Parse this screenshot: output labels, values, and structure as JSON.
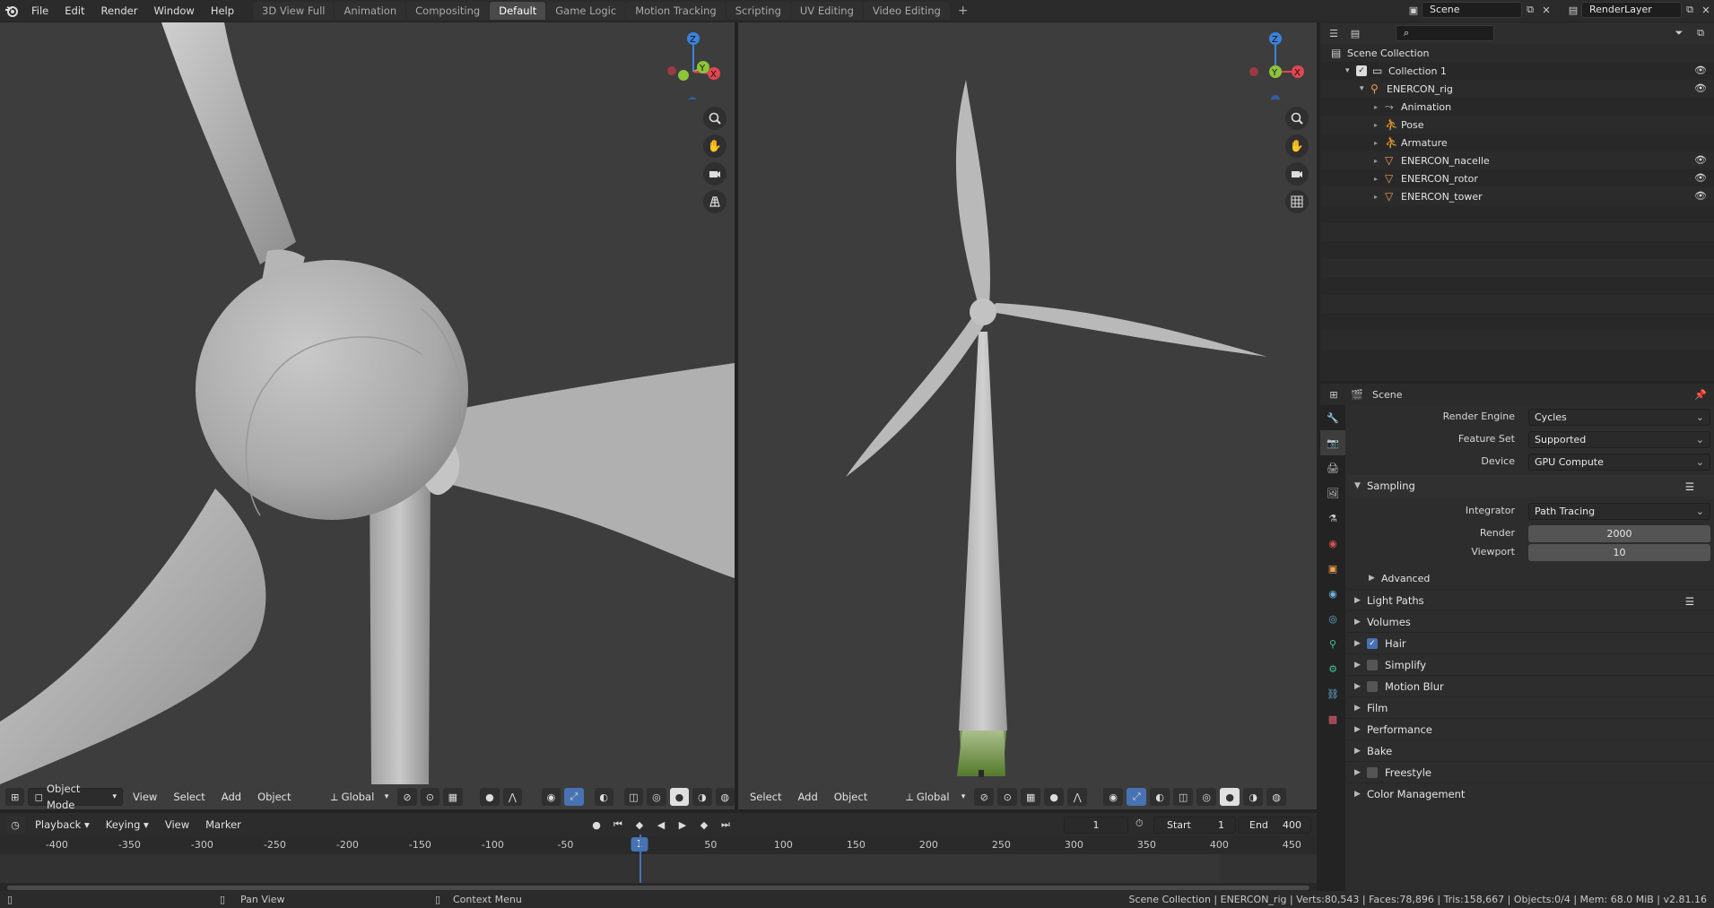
{
  "menu": [
    "File",
    "Edit",
    "Render",
    "Window",
    "Help"
  ],
  "workspace_tabs": [
    {
      "label": "3D View Full",
      "active": false
    },
    {
      "label": "Animation",
      "active": false
    },
    {
      "label": "Compositing",
      "active": false
    },
    {
      "label": "Default",
      "active": true
    },
    {
      "label": "Game Logic",
      "active": false
    },
    {
      "label": "Motion Tracking",
      "active": false
    },
    {
      "label": "Scripting",
      "active": false
    },
    {
      "label": "UV Editing",
      "active": false
    },
    {
      "label": "Video Editing",
      "active": false
    }
  ],
  "add_tab": "+",
  "scene": "Scene",
  "render_layer": "RenderLayer",
  "left_viewport": {
    "mode": "Object Mode",
    "menus": [
      "View",
      "Select",
      "Add",
      "Object"
    ],
    "orientation": "Global"
  },
  "right_viewport": {
    "menus": [
      "Select",
      "Add",
      "Object"
    ],
    "orientation": "Global"
  },
  "gizmo_axes": {
    "z": "Z",
    "y": "Y",
    "x": "X"
  },
  "outliner": {
    "rows": [
      {
        "label": "Scene Collection",
        "indent": 0,
        "icon": "scene-collection-icon",
        "eye": false
      },
      {
        "label": "Collection 1",
        "indent": 1,
        "icon": "collection-icon",
        "eye": true
      },
      {
        "label": "ENERCON_rig",
        "indent": 2,
        "icon": "armature-object-icon",
        "eye": true
      },
      {
        "label": "Animation",
        "indent": 3,
        "icon": "animation-icon",
        "eye": false
      },
      {
        "label": "Pose",
        "indent": 3,
        "icon": "pose-icon",
        "eye": false
      },
      {
        "label": "Armature",
        "indent": 3,
        "icon": "armature-data-icon",
        "eye": false
      },
      {
        "label": "ENERCON_nacelle",
        "indent": 3,
        "icon": "mesh-object-icon",
        "eye": true
      },
      {
        "label": "ENERCON_rotor",
        "indent": 3,
        "icon": "mesh-object-icon",
        "eye": true
      },
      {
        "label": "ENERCON_tower",
        "indent": 3,
        "icon": "mesh-object-icon",
        "eye": true
      }
    ]
  },
  "properties": {
    "context": "Scene",
    "render_engine_label": "Render Engine",
    "render_engine": "Cycles",
    "feature_set_label": "Feature Set",
    "feature_set": "Supported",
    "device_label": "Device",
    "device": "GPU Compute",
    "sampling": "Sampling",
    "integrator_label": "Integrator",
    "integrator": "Path Tracing",
    "render_label": "Render",
    "render_samples": "2000",
    "viewport_label": "Viewport",
    "viewport_samples": "10",
    "advanced": "Advanced",
    "panels": [
      {
        "label": "Light Paths",
        "checkbox": null,
        "list": true
      },
      {
        "label": "Volumes",
        "checkbox": null,
        "list": false
      },
      {
        "label": "Hair",
        "checkbox": true,
        "list": false
      },
      {
        "label": "Simplify",
        "checkbox": false,
        "list": false
      },
      {
        "label": "Motion Blur",
        "checkbox": false,
        "list": false
      },
      {
        "label": "Film",
        "checkbox": null,
        "list": false
      },
      {
        "label": "Performance",
        "checkbox": null,
        "list": false
      },
      {
        "label": "Bake",
        "checkbox": null,
        "list": false
      },
      {
        "label": "Freestyle",
        "checkbox": false,
        "list": false
      },
      {
        "label": "Color Management",
        "checkbox": null,
        "list": false
      }
    ]
  },
  "timeline": {
    "menus": [
      "Playback",
      "Keying",
      "View",
      "Marker"
    ],
    "current_frame": "1",
    "start_label": "Start",
    "start": "1",
    "end_label": "End",
    "end": "400",
    "ticks": [
      "-400",
      "-350",
      "-300",
      "-250",
      "-200",
      "-150",
      "-100",
      "-50",
      "1",
      "50",
      "100",
      "150",
      "200",
      "250",
      "300",
      "350",
      "400",
      "450"
    ]
  },
  "status": {
    "pan": "Pan View",
    "context_menu": "Context Menu",
    "stats": "Scene Collection | ENERCON_rig | Verts:80,543 | Faces:78,896 | Tris:158,667 | Objects:0/4 | Mem: 68.0 MiB | v2.81.16"
  },
  "colors": {
    "accent": "#4772b3",
    "axis_x": "#e2454f",
    "axis_y": "#8cc43a",
    "axis_z": "#3b82dc",
    "viewport_bg": "#3d3d3d"
  }
}
